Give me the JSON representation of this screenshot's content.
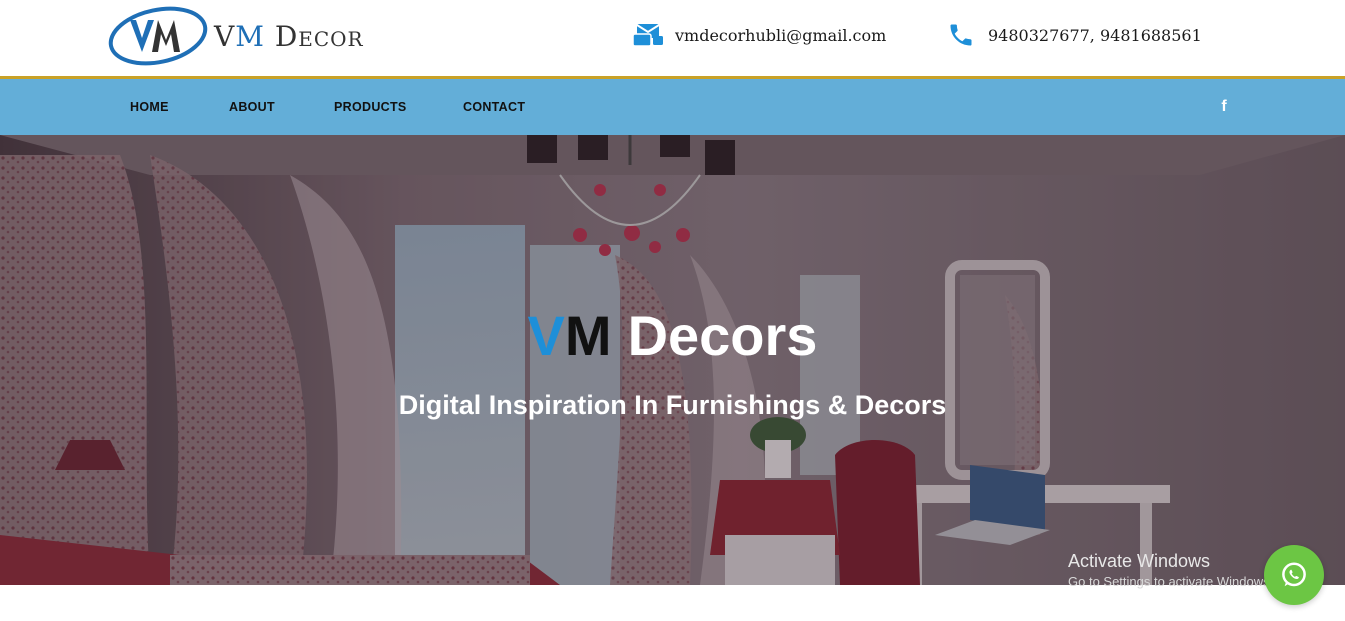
{
  "header": {
    "logo": {
      "letters_v": "V",
      "letters_m": "M",
      "rest": "Decor",
      "icon": "vm-logo-icon"
    },
    "email": {
      "icon": "email-icon",
      "text": "vmdecorhubli@gmail.com"
    },
    "phone": {
      "icon": "phone-icon",
      "text": "9480327677, 9481688561"
    }
  },
  "nav": {
    "items": [
      {
        "label": "HOME"
      },
      {
        "label": "ABOUT"
      },
      {
        "label": "PRODUCTS"
      },
      {
        "label": "CONTACT"
      }
    ],
    "social": {
      "icon": "facebook-icon",
      "glyph": "f"
    }
  },
  "hero": {
    "title_v": "V",
    "title_m": "M",
    "title_rest": "Decors",
    "subtitle": "Digital Inspiration In Furnishings & Decors"
  },
  "overlay": {
    "activate_title": "Activate Windows",
    "activate_sub": "Go to Settings to activate Windows."
  },
  "whatsapp": {
    "icon": "whatsapp-icon"
  },
  "colors": {
    "nav_bg": "#63aed8",
    "accent_line": "#c9a227",
    "brand_blue": "#1e8fd8",
    "whatsapp_green": "#6cc644"
  }
}
